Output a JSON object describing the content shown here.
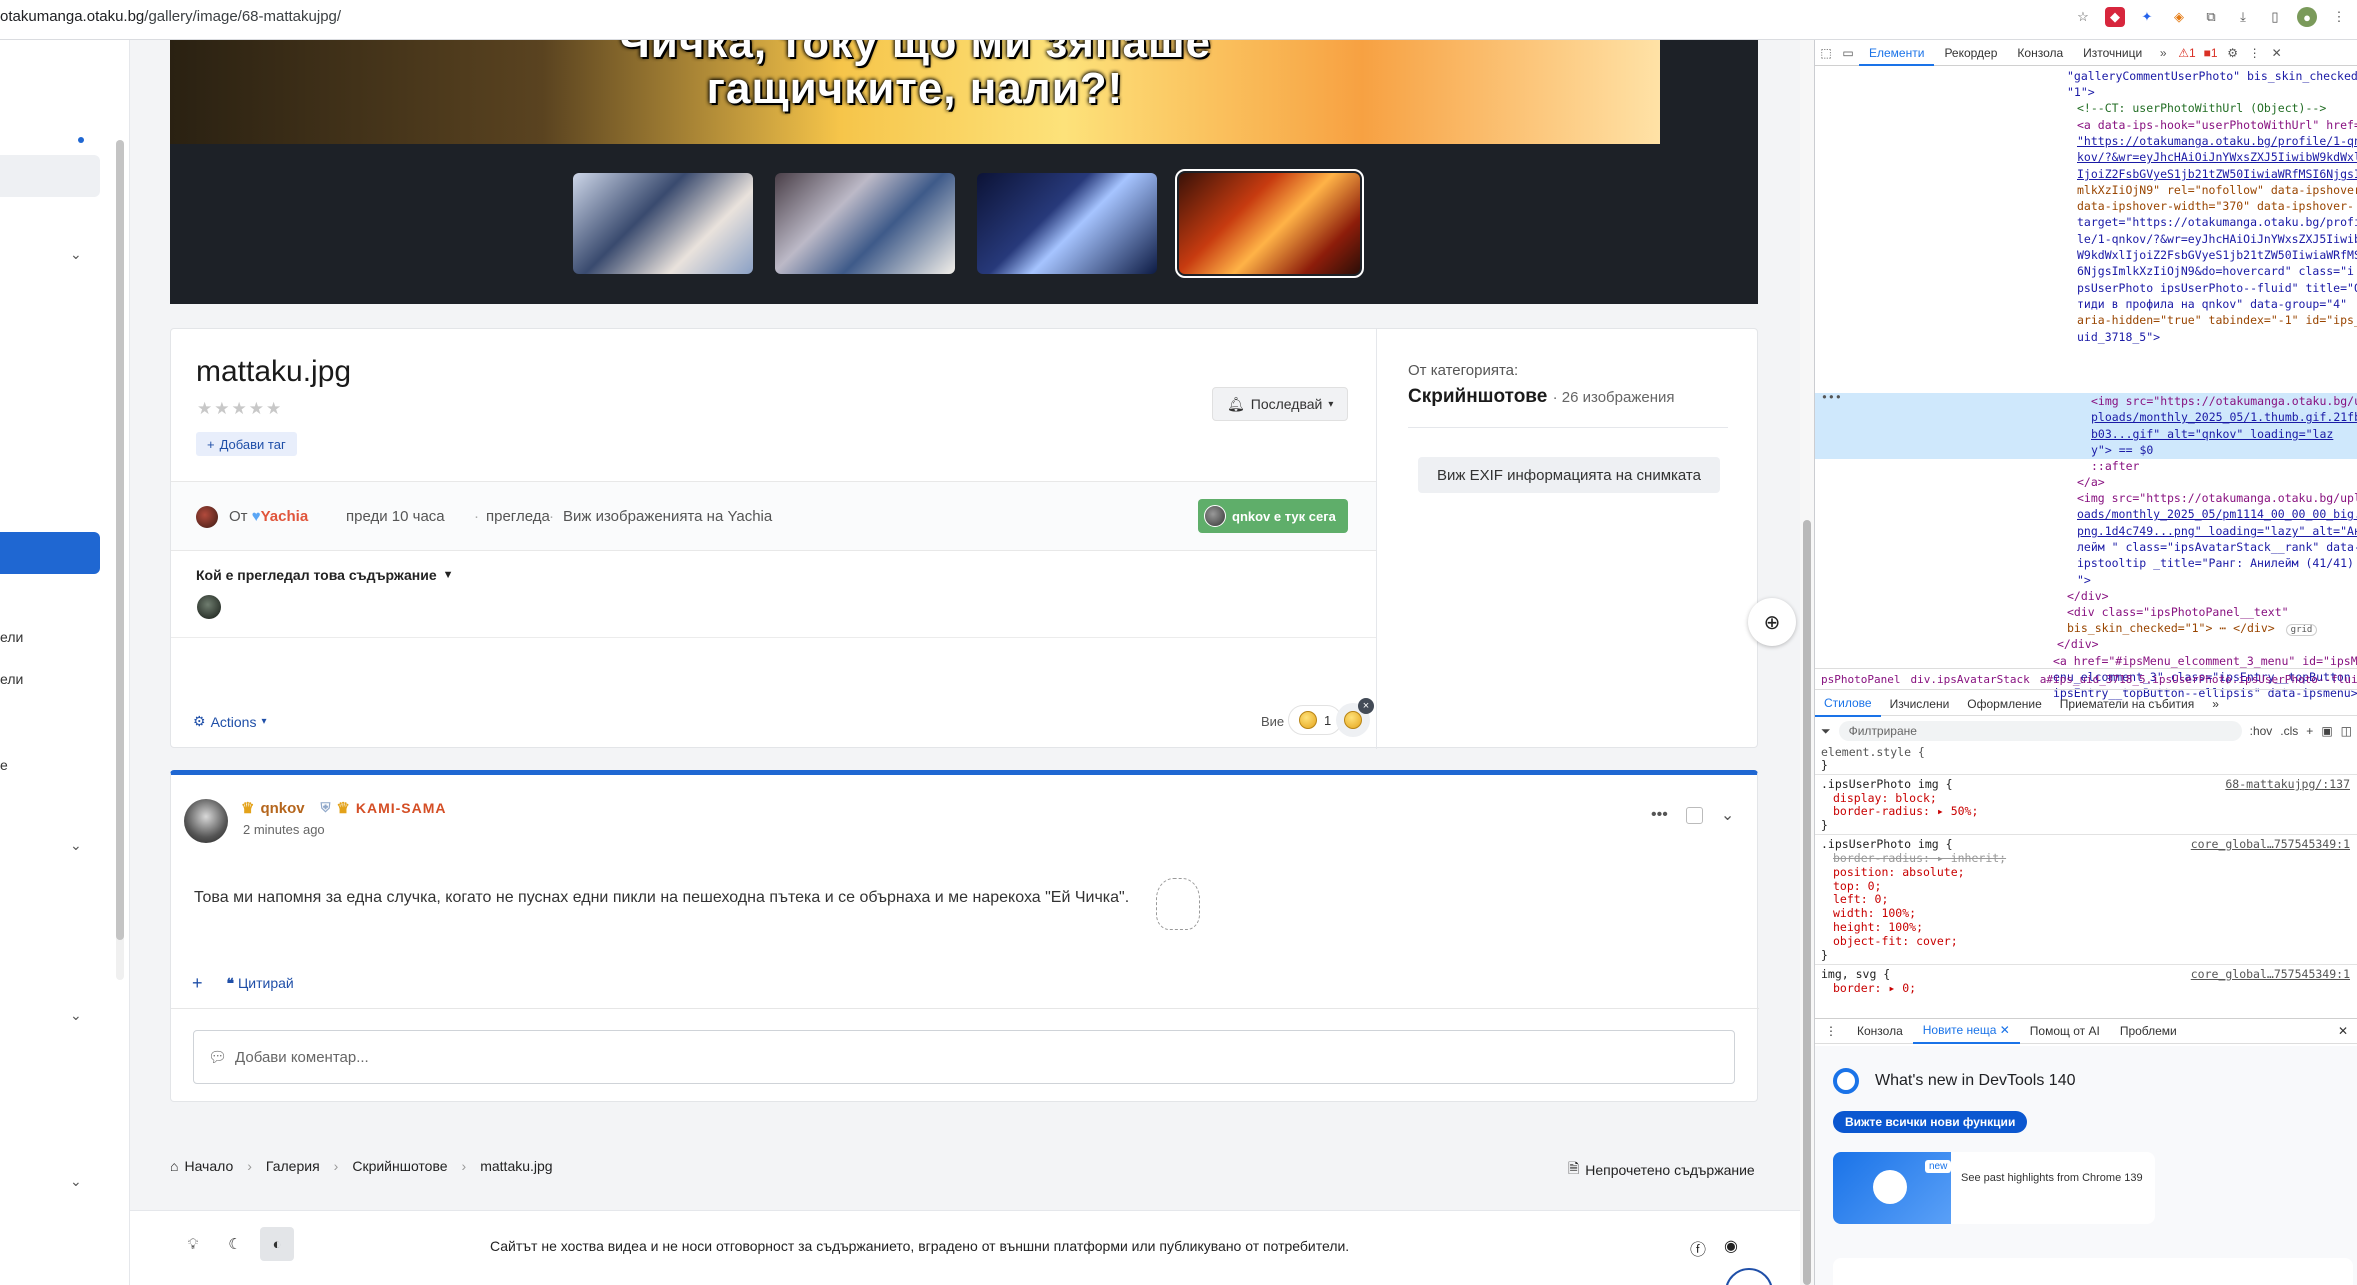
{
  "browser": {
    "url_host": "otakumanga.otaku.bg",
    "url_path": "/gallery/image/68-mattakujpg/"
  },
  "sidebar": {
    "items": [
      {
        "label": "ели"
      },
      {
        "label": "ели"
      },
      {
        "label": "е"
      }
    ]
  },
  "viewer": {
    "caption_line1": "Чичка, току що ми зяпаше",
    "caption_line2": "гащичките, нали?!"
  },
  "image": {
    "title": "mattaku.jpg",
    "add_tag_label": "Добави таг",
    "follow_label": "Последвай",
    "author_prefix": "От",
    "author_name": "Yachia",
    "posted_ago": "преди 10 часа",
    "views_label": "прегледа",
    "view_images_link": "Виж изображенията на Yachia",
    "online_badge": "qnkov е тук сега",
    "viewers_title": "Кой е прегледал това съдържание",
    "actions_label": "Actions",
    "you_label": "Вие",
    "reaction_count": "1"
  },
  "category": {
    "label": "От категорията:",
    "name": "Скрийншотове",
    "count": "· 26 изображения",
    "exif_button": "Виж EXIF информацията на снимката"
  },
  "comment": {
    "author": "qnkov",
    "rank": "KAMI-SAMA",
    "time": "2 minutes ago",
    "text": "Това ми напомня за една случка, когато не пуснах едни пикли на пешеходна пътека и се обърнаха и ме нарекоха \"Ей Чичка\".",
    "quote_label": "Цитирай",
    "input_placeholder": "Добави коментар..."
  },
  "breadcrumb": {
    "items": [
      "Начало",
      "Галерия",
      "Скрийншотове",
      "mattaku.jpg"
    ],
    "unread_label": "Непрочетено съдържание"
  },
  "footer": {
    "disclaimer": "Сайтът не хоства видеа и не носи отговорност за съдържанието, вградено от външни платформи или публикувано от потребители."
  },
  "devtools": {
    "tabs": [
      "Елементи",
      "Рекордер",
      "Конзола",
      "Източници"
    ],
    "warn_count": "1",
    "err_count": "1",
    "dom_lines": {
      "l1": "\"galleryCommentUserPhoto\" bis_skin_checked=",
      "l2": "\"1\">",
      "l3": "<!--CT: userPhotoWithUrl (Object)-->",
      "l4a": "<a data-ips-hook=\"userPhotoWithUrl\" href=",
      "l5": "\"https://otakumanga.otaku.bg/profile/1-qn",
      "l6": "kov/?&wr=eyJhcHAiOiJnYWxsZXJ5IiwibW9kdWxl",
      "l7": "IjoiZ2FsbGVyeS1jb21tZW50IiwiaWRfMSI6NjgsI",
      "l8": "mlkXzIiOjN9\" rel=\"nofollow\" data-ipshover",
      "l9": "data-ipshover-width=\"370\" data-ipshover-",
      "l10": "target=\"https://otakumanga.otaku.bg/profi",
      "l11": "le/1-qnkov/?&wr=eyJhcHAiOiJnYWxsZXJ5Iiwib",
      "l12": "W9kdWxlIjoiZ2FsbGVyeS1jb21tZW50IiwiaWRfMSI",
      "l13": "6NjgsImlkXzIiOjN9&do=hovercard\" class=\"i",
      "l14": "psUserPhoto ipsUserPhoto--fluid\" title=\"O",
      "l15": "тиди в профила на qnkov\" data-group=\"4\"",
      "l16": "aria-hidden=\"true\" tabindex=\"-1\" id=\"ips_",
      "l17": "uid_3718_5\">",
      "l18": "<img src=\"https://otakumanga.otaku.bg/u",
      "l19": "ploads/monthly_2025_05/1.thumb.gif.21fb",
      "l20": "b03...gif\" alt=\"qnkov\" loading=\"laz",
      "l21": "y\"> == $0",
      "l22": "::after",
      "l23": "</a>",
      "l24": "<img src=\"https://otakumanga.otaku.bg/upl",
      "l25": "oads/monthly_2025_05/pm1114_00_00_00_big.",
      "l26": "png.1d4c749...png\" loading=\"lazy\" alt=\"Ани",
      "l27": "лейм \" class=\"ipsAvatarStack__rank\" data-",
      "l28": "ipstooltip _title=\"Ранг: Анилейм  (41/41)",
      "l29": "\">",
      "l30": "</div>",
      "l31": "<div class=\"ipsPhotoPanel__text\"",
      "l32": "bis_skin_checked=\"1\"> ⋯ </div>",
      "l32b": "grid",
      "l33": "</div>",
      "l34": "<a href=\"#ipsMenu_elcomment_3_menu\" id=\"ipsM",
      "l35": "enu_elcomment_3\" class=\"ipsEntry__topButton",
      "l36": "ipsEntry__topButton--ellipsis\" data-ipsmenu>"
    },
    "breadcrumb": [
      "psPhotoPanel",
      "div.ipsAvatarStack",
      "a#ips_uid_3718_5.ipsUserPhoto.ipsUserPhoto--fluid",
      "img"
    ],
    "style_tabs": [
      "Стилове",
      "Изчислени",
      "Оформление",
      "Приематели на събития"
    ],
    "filter_placeholder": "Филтриране",
    "filter_hov": ":hov",
    "filter_cls": ".cls",
    "rules": {
      "r1": "element.style {",
      "r2": "}",
      "r3": ".ipsUserPhoto img {",
      "r3src": "68-mattakujpg/:137",
      "r4": "display: block;",
      "r5": "border-radius: ▸ 50%;",
      "r6": "}",
      "r7": ".ipsUserPhoto img {",
      "r7src": "core_global…757545349:1",
      "r8": "border-radius: ▸ inherit;",
      "r9": "position: absolute;",
      "r10": "top: 0;",
      "r11": "left: 0;",
      "r12": "width: 100%;",
      "r13": "height: 100%;",
      "r14": "object-fit: cover;",
      "r15": "}",
      "r16": "img, svg {",
      "r16src": "core_global…757545349:1",
      "r17": "border: ▸ 0;"
    },
    "drawer_tabs": [
      "Конзола",
      "Новите неща",
      "Помощ от AI",
      "Проблеми"
    ],
    "whatsnew_title": "What's new in DevTools 140",
    "whatsnew_button": "Вижте всички нови функции",
    "whatsnew_new": "new",
    "whatsnew_highlight": "See past highlights from Chrome 139"
  }
}
